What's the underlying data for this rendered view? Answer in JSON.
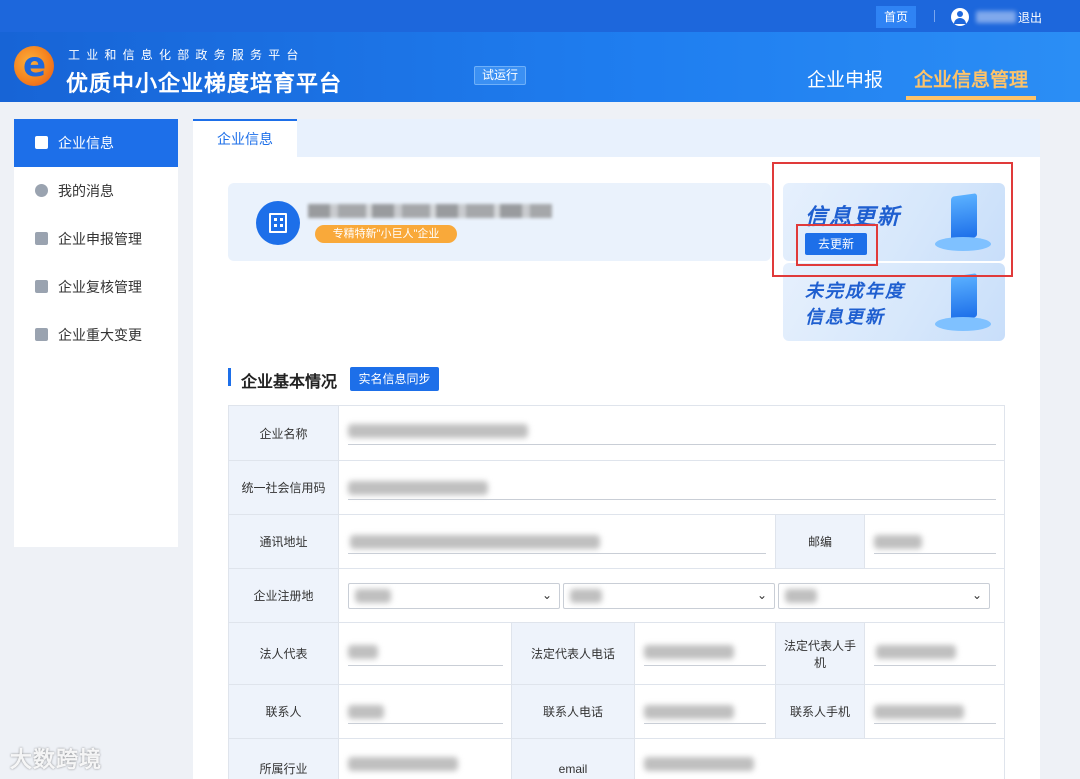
{
  "topbar": {
    "home": "首页",
    "logout": "退出"
  },
  "header": {
    "subtitle": "工业和信息化部政务服务平台",
    "title": "优质中小企业梯度培育平台",
    "trial_badge": "试运行",
    "nav": [
      {
        "label": "企业申报"
      },
      {
        "label": "企业信息管理"
      }
    ]
  },
  "sidebar": {
    "items": [
      {
        "label": "企业信息",
        "icon": "building-icon"
      },
      {
        "label": "我的消息",
        "icon": "message-icon"
      },
      {
        "label": "企业申报管理",
        "icon": "edit-icon"
      },
      {
        "label": "企业复核管理",
        "icon": "bookmark-icon"
      },
      {
        "label": "企业重大变更",
        "icon": "document-icon"
      }
    ]
  },
  "tab": {
    "label": "企业信息"
  },
  "company": {
    "badge": "专精特新\"小巨人\"企业"
  },
  "banners": {
    "update": {
      "title": "信息更新",
      "button": "去更新"
    },
    "annual": {
      "title_line1": "未完成年度",
      "title_line2": "信息更新"
    }
  },
  "basic_info": {
    "title": "企业基本情况",
    "sync_button": "实名信息同步",
    "labels": {
      "company_name": "企业名称",
      "credit_code": "统一社会信用码",
      "address": "通讯地址",
      "postcode": "邮编",
      "register_place": "企业注册地",
      "legal_rep": "法人代表",
      "legal_rep_phone": "法定代表人电话",
      "legal_rep_mobile": "法定代表人手机",
      "contact": "联系人",
      "contact_phone": "联系人电话",
      "contact_mobile": "联系人手机",
      "industry": "所属行业",
      "email": "email"
    }
  },
  "watermark": "大数跨境",
  "colors": {
    "primary": "#1d6fe9",
    "accent": "#fdc36a",
    "badge": "#f9a93a",
    "highlight": "#e03a3a"
  }
}
